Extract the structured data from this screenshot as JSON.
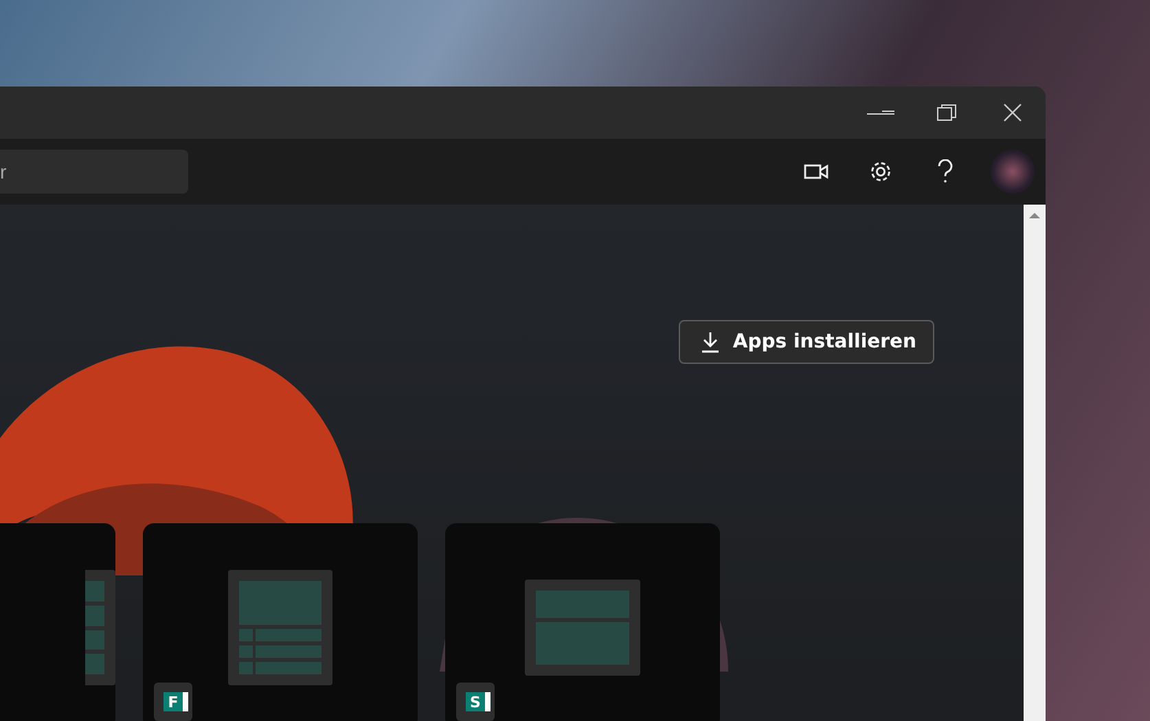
{
  "toolbar": {
    "search": {
      "placeholder": "r"
    }
  },
  "content": {
    "install_button": "Apps installieren",
    "templates": [
      {
        "kind": "rows"
      },
      {
        "kind": "form",
        "app_letter": "F"
      },
      {
        "kind": "split",
        "app_letter": "S"
      }
    ]
  }
}
